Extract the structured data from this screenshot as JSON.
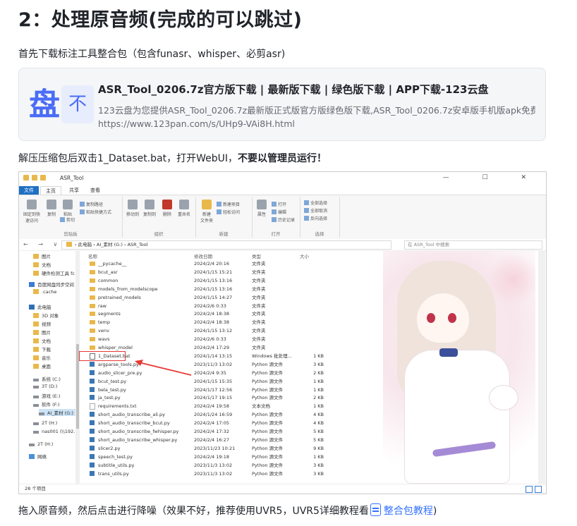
{
  "heading": "2：处理原音频(完成的可以跳过)",
  "para1": "首先下载标注工具整合包（包含funasr、whisper、必剪asr)",
  "card": {
    "logo_char": "盘",
    "logo2_char": "不",
    "title": "ASR_Tool_0206.7z官方版下载 | 最新版下载 | 绿色版下载 | APP下载-123云盘",
    "desc": "123云盘为您提供ASR_Tool_0206.7z最新版正式版官方版绿色版下载,ASR_Tool_0206.7z安卓版手机版apk免费下...",
    "url": "https://www.123pan.com/s/UHp9-VAi8H.html"
  },
  "para2": {
    "normal": "解压压缩包后双击1_Dataset.bat，打开WebUI，",
    "bold": "不要以管理员运行！"
  },
  "para3": {
    "prefix": "拖入原音频，然后点击进行降噪（效果不好，推荐使用UVR5，UVR5详细教程看",
    "link": "整合包教程",
    "suffix": ")"
  },
  "explorer": {
    "title": "ASR_Tool",
    "window_controls": "— ☐ ✕",
    "tabs": [
      "文件",
      "主页",
      "共享",
      "查看"
    ],
    "ribbon": {
      "pin": "固定到快\n速访问",
      "copy": "复制",
      "paste": "粘贴",
      "copy_path": "复制路径",
      "paste_shortcut": "粘贴快捷方式",
      "cut": "剪切",
      "group_clipboard": "剪贴板",
      "move_to": "移动到",
      "copy_to": "复制到",
      "delete": "删除",
      "rename": "重命名",
      "group_organize": "组织",
      "new_folder": "新建\n文件夹",
      "new_item": "新建项目",
      "easy_access": "轻松访问",
      "group_new": "新建",
      "properties": "属性",
      "open": "打开",
      "edit": "编辑",
      "history": "历史记录",
      "group_open": "打开",
      "select_all": "全部选择",
      "select_none": "全部取消",
      "invert": "反向选择",
      "group_select": "选择"
    },
    "nav_buttons": "← → ∨ ↑",
    "address": "› 此电脑 › AI_素材 (G:) › ASR_Tool",
    "search_placeholder": "在 ASR_Tool 中搜索",
    "columns": {
      "name": "名称",
      "date": "修改日期",
      "type": "类型",
      "size": "大小"
    },
    "nav_items": [
      "图片",
      "文档",
      "硬件检测工具 fc",
      "百度网盘同步空间",
      ".cache",
      "此电脑",
      "3D 对象",
      "视频",
      "图片",
      "文档",
      "下载",
      "音乐",
      "桌面",
      "系统 (C:)",
      "3T (D:)",
      "游戏 (E:)",
      "软件 (F:)",
      "AI_素材 (G:)",
      "2T (H:)",
      "nas001 (\\\\192.",
      "2T (H:)",
      "网络"
    ],
    "files": [
      {
        "name": "__pycache__",
        "date": "2024/2/4 20:16",
        "type": "文件夹",
        "size": "",
        "kind": "folder"
      },
      {
        "name": "bcut_asr",
        "date": "2024/1/15 15:21",
        "type": "文件夹",
        "size": "",
        "kind": "folder"
      },
      {
        "name": "common",
        "date": "2024/1/15 13:16",
        "type": "文件夹",
        "size": "",
        "kind": "folder"
      },
      {
        "name": "models_from_modelscope",
        "date": "2024/1/15 13:16",
        "type": "文件夹",
        "size": "",
        "kind": "folder"
      },
      {
        "name": "pretrained_models",
        "date": "2024/1/15 14:27",
        "type": "文件夹",
        "size": "",
        "kind": "folder"
      },
      {
        "name": "raw",
        "date": "2024/2/6 0:33",
        "type": "文件夹",
        "size": "",
        "kind": "folder"
      },
      {
        "name": "segments",
        "date": "2024/2/4 18:38",
        "type": "文件夹",
        "size": "",
        "kind": "folder"
      },
      {
        "name": "temp",
        "date": "2024/2/4 18:38",
        "type": "文件夹",
        "size": "",
        "kind": "folder"
      },
      {
        "name": "venv",
        "date": "2024/1/15 13:12",
        "type": "文件夹",
        "size": "",
        "kind": "folder"
      },
      {
        "name": "wavs",
        "date": "2024/2/6 0:33",
        "type": "文件夹",
        "size": "",
        "kind": "folder"
      },
      {
        "name": "whisper_model",
        "date": "2024/2/4 17:29",
        "type": "文件夹",
        "size": "",
        "kind": "folder"
      },
      {
        "name": "1_Dataset.bat",
        "date": "2024/1/14 13:15",
        "type": "Windows 批处理...",
        "size": "1 KB",
        "kind": "bat"
      },
      {
        "name": "argparse_tools.py",
        "date": "2023/11/3 13:02",
        "type": "Python 源文件",
        "size": "3 KB",
        "kind": "py"
      },
      {
        "name": "audio_slicer_pre.py",
        "date": "2024/2/4 9:35",
        "type": "Python 源文件",
        "size": "2 KB",
        "kind": "py"
      },
      {
        "name": "bcut_test.py",
        "date": "2024/1/15 15:35",
        "type": "Python 源文件",
        "size": "1 KB",
        "kind": "py"
      },
      {
        "name": "bela_test.py",
        "date": "2024/1/17 12:56",
        "type": "Python 源文件",
        "size": "1 KB",
        "kind": "py"
      },
      {
        "name": "ja_test.py",
        "date": "2024/1/17 19:15",
        "type": "Python 源文件",
        "size": "2 KB",
        "kind": "py"
      },
      {
        "name": "requirements.txt",
        "date": "2024/2/4 19:58",
        "type": "文本文档",
        "size": "1 KB",
        "kind": "txt"
      },
      {
        "name": "short_audio_transcribe_ali.py",
        "date": "2024/1/24 16:59",
        "type": "Python 源文件",
        "size": "4 KB",
        "kind": "py"
      },
      {
        "name": "short_audio_transcribe_bcut.py",
        "date": "2024/2/4 17:05",
        "type": "Python 源文件",
        "size": "4 KB",
        "kind": "py"
      },
      {
        "name": "short_audio_transcribe_fwhisper.py",
        "date": "2024/2/4 17:32",
        "type": "Python 源文件",
        "size": "5 KB",
        "kind": "py"
      },
      {
        "name": "short_audio_transcribe_whisper.py",
        "date": "2024/2/4 16:27",
        "type": "Python 源文件",
        "size": "5 KB",
        "kind": "py"
      },
      {
        "name": "slicer2.py",
        "date": "2023/11/23 10:21",
        "type": "Python 源文件",
        "size": "9 KB",
        "kind": "py"
      },
      {
        "name": "speech_test.py",
        "date": "2024/2/4 19:18",
        "type": "Python 源文件",
        "size": "1 KB",
        "kind": "py"
      },
      {
        "name": "subtitle_utils.py",
        "date": "2023/11/3 13:02",
        "type": "Python 源文件",
        "size": "3 KB",
        "kind": "py"
      },
      {
        "name": "trans_utils.py",
        "date": "2023/11/3 13:02",
        "type": "Python 源文件",
        "size": "3 KB",
        "kind": "py"
      }
    ],
    "highlighted_file_index": 11,
    "status_count": "28 个项目",
    "accent": "#1f6fc4",
    "highlight_color": "#e53935"
  }
}
